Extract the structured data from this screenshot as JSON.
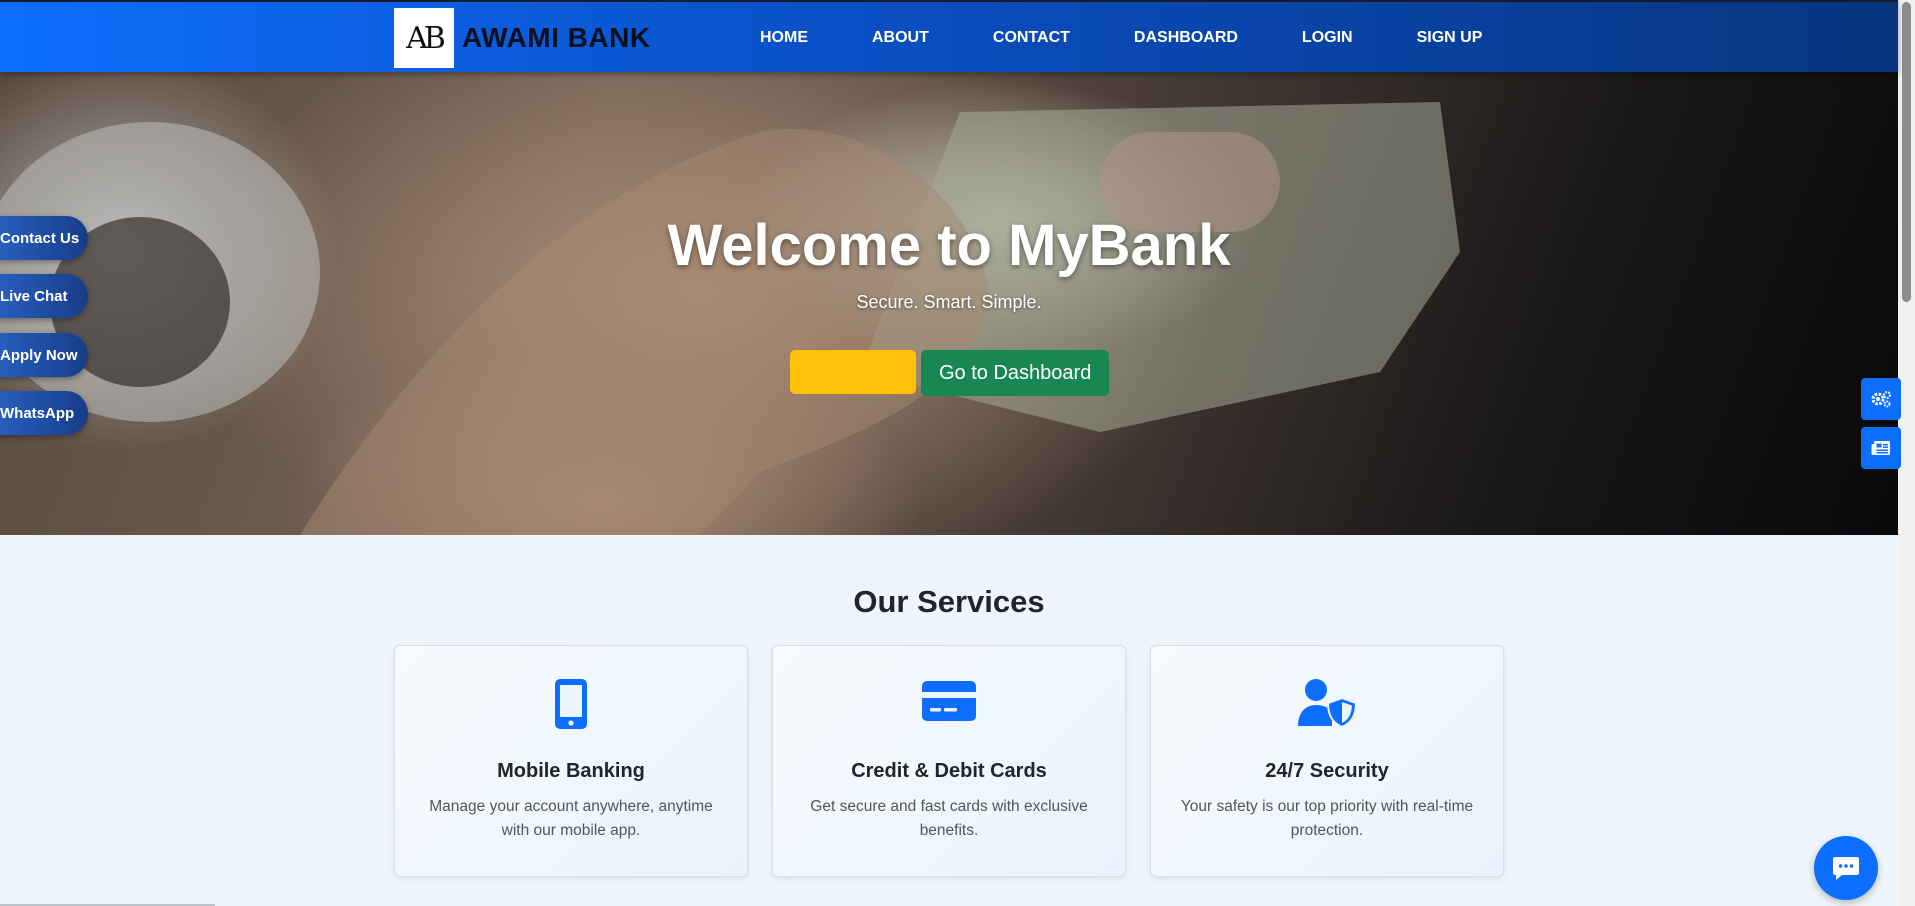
{
  "brand": {
    "logo_text": "AB",
    "name": "AWAMI BANK"
  },
  "nav": {
    "items": [
      "HOME",
      "ABOUT",
      "CONTACT",
      "DASHBOARD",
      "LOGIN",
      "SIGN UP"
    ]
  },
  "hero": {
    "title": "Welcome to MyBank",
    "subtitle": "Secure. Smart. Simple.",
    "primary_button_label": "",
    "dashboard_button_label": "Go to Dashboard"
  },
  "floating": {
    "items": [
      "Contact Us",
      "Live Chat",
      "Apply Now",
      "WhatsApp"
    ]
  },
  "right_tools": {
    "items": [
      "settings-gears-icon",
      "newspaper-icon"
    ]
  },
  "services": {
    "title": "Our Services",
    "cards": [
      {
        "icon": "mobile-phone-icon",
        "title": "Mobile Banking",
        "text": "Manage your account anywhere, anytime with our mobile app."
      },
      {
        "icon": "credit-card-icon",
        "title": "Credit & Debit Cards",
        "text": "Get secure and fast cards with exclusive benefits."
      },
      {
        "icon": "user-shield-icon",
        "title": "24/7 Security",
        "text": "Your safety is our top priority with real-time protection."
      }
    ]
  },
  "chat": {
    "icon": "chat-icon"
  },
  "colors": {
    "primary": "#0d6efd",
    "nav_dark": "#07357e",
    "warning": "#ffc107",
    "success": "#198754"
  }
}
